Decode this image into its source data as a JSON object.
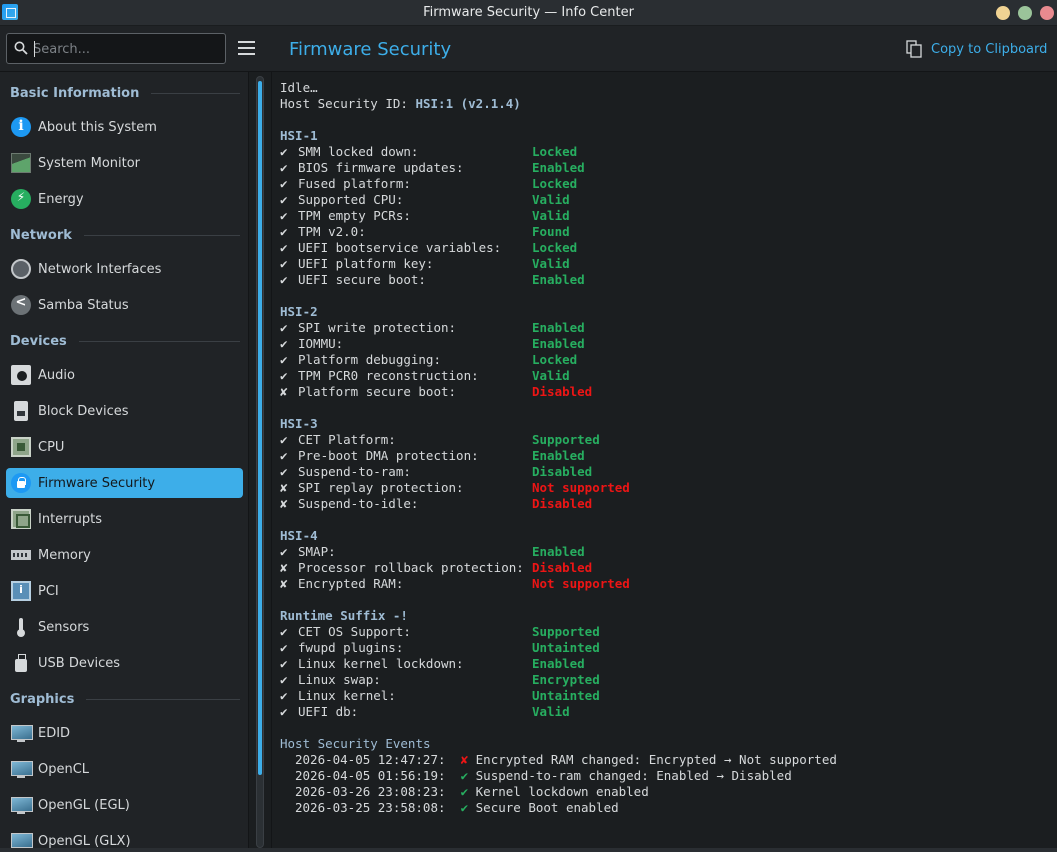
{
  "window": {
    "title": "Firmware Security — Info Center"
  },
  "search": {
    "placeholder": "Search..."
  },
  "header": {
    "title": "Firmware Security",
    "copy_label": "Copy to Clipboard"
  },
  "sidebar": {
    "sections": [
      {
        "label": "Basic Information"
      },
      {
        "label": "Network"
      },
      {
        "label": "Devices"
      },
      {
        "label": "Graphics"
      }
    ],
    "items": [
      {
        "label": "About this System",
        "icon": "info-icon"
      },
      {
        "label": "System Monitor",
        "icon": "system-monitor-icon"
      },
      {
        "label": "Energy",
        "icon": "energy-icon"
      },
      {
        "label": "Network Interfaces",
        "icon": "network-icon"
      },
      {
        "label": "Samba Status",
        "icon": "samba-icon"
      },
      {
        "label": "Audio",
        "icon": "audio-icon"
      },
      {
        "label": "Block Devices",
        "icon": "block-device-icon"
      },
      {
        "label": "CPU",
        "icon": "cpu-icon"
      },
      {
        "label": "Firmware Security",
        "icon": "lock-icon",
        "active": true
      },
      {
        "label": "Interrupts",
        "icon": "interrupts-icon"
      },
      {
        "label": "Memory",
        "icon": "memory-icon"
      },
      {
        "label": "PCI",
        "icon": "pci-icon"
      },
      {
        "label": "Sensors",
        "icon": "sensor-icon"
      },
      {
        "label": "USB Devices",
        "icon": "usb-icon"
      },
      {
        "label": "EDID",
        "icon": "display-icon"
      },
      {
        "label": "OpenCL",
        "icon": "display-icon"
      },
      {
        "label": "OpenGL (EGL)",
        "icon": "display-icon"
      },
      {
        "label": "OpenGL (GLX)",
        "icon": "display-icon"
      }
    ]
  },
  "content": {
    "status": "Idle…",
    "host_id_label": "Host Security ID: ",
    "host_id_value": "HSI:1 (v2.1.4)",
    "check_mark": "✔",
    "cross_mark": "✘",
    "groups": [
      {
        "title": "HSI-1",
        "rows": [
          {
            "pass": true,
            "name": "SMM locked down:",
            "value": "Locked"
          },
          {
            "pass": true,
            "name": "BIOS firmware updates:",
            "value": "Enabled"
          },
          {
            "pass": true,
            "name": "Fused platform:",
            "value": "Locked"
          },
          {
            "pass": true,
            "name": "Supported CPU:",
            "value": "Valid"
          },
          {
            "pass": true,
            "name": "TPM empty PCRs:",
            "value": "Valid"
          },
          {
            "pass": true,
            "name": "TPM v2.0:",
            "value": "Found"
          },
          {
            "pass": true,
            "name": "UEFI bootservice variables:",
            "value": "Locked"
          },
          {
            "pass": true,
            "name": "UEFI platform key:",
            "value": "Valid"
          },
          {
            "pass": true,
            "name": "UEFI secure boot:",
            "value": "Enabled"
          }
        ]
      },
      {
        "title": "HSI-2",
        "rows": [
          {
            "pass": true,
            "name": "SPI write protection:",
            "value": "Enabled"
          },
          {
            "pass": true,
            "name": "IOMMU:",
            "value": "Enabled"
          },
          {
            "pass": true,
            "name": "Platform debugging:",
            "value": "Locked"
          },
          {
            "pass": true,
            "name": "TPM PCR0 reconstruction:",
            "value": "Valid"
          },
          {
            "pass": false,
            "name": "Platform secure boot:",
            "value": "Disabled"
          }
        ]
      },
      {
        "title": "HSI-3",
        "rows": [
          {
            "pass": true,
            "name": "CET Platform:",
            "value": "Supported"
          },
          {
            "pass": true,
            "name": "Pre-boot DMA protection:",
            "value": "Enabled"
          },
          {
            "pass": true,
            "name": "Suspend-to-ram:",
            "value": "Disabled"
          },
          {
            "pass": false,
            "name": "SPI replay protection:",
            "value": "Not supported"
          },
          {
            "pass": false,
            "name": "Suspend-to-idle:",
            "value": "Disabled"
          }
        ]
      },
      {
        "title": "HSI-4",
        "rows": [
          {
            "pass": true,
            "name": "SMAP:",
            "value": "Enabled"
          },
          {
            "pass": false,
            "name": "Processor rollback protection:",
            "value": "Disabled"
          },
          {
            "pass": false,
            "name": "Encrypted RAM:",
            "value": "Not supported"
          }
        ]
      },
      {
        "title": "Runtime Suffix -!",
        "rows": [
          {
            "pass": true,
            "name": "CET OS Support:",
            "value": "Supported"
          },
          {
            "pass": true,
            "name": "fwupd plugins:",
            "value": "Untainted"
          },
          {
            "pass": true,
            "name": "Linux kernel lockdown:",
            "value": "Enabled"
          },
          {
            "pass": true,
            "name": "Linux swap:",
            "value": "Encrypted"
          },
          {
            "pass": true,
            "name": "Linux kernel:",
            "value": "Untainted"
          },
          {
            "pass": true,
            "name": "UEFI db:",
            "value": "Valid"
          }
        ]
      }
    ],
    "events_title": "Host Security Events",
    "events": [
      {
        "timestamp": "2026-04-05 12:47:27:",
        "pass": false,
        "mark": "✘",
        "message": "Encrypted RAM changed: Encrypted → Not supported"
      },
      {
        "timestamp": "2026-04-05 01:56:19:",
        "pass": true,
        "mark": "✔",
        "message": "Suspend-to-ram changed: Enabled → Disabled"
      },
      {
        "timestamp": "2026-03-26 23:08:23:",
        "pass": true,
        "mark": "✔",
        "message": "Kernel lockdown enabled"
      },
      {
        "timestamp": "2026-03-25 23:58:08:",
        "pass": true,
        "mark": "✔",
        "message": "Secure Boot enabled"
      }
    ]
  },
  "colors": {
    "accent": "#3daee9",
    "pass": "#27ae60",
    "fail": "#ed1515"
  }
}
